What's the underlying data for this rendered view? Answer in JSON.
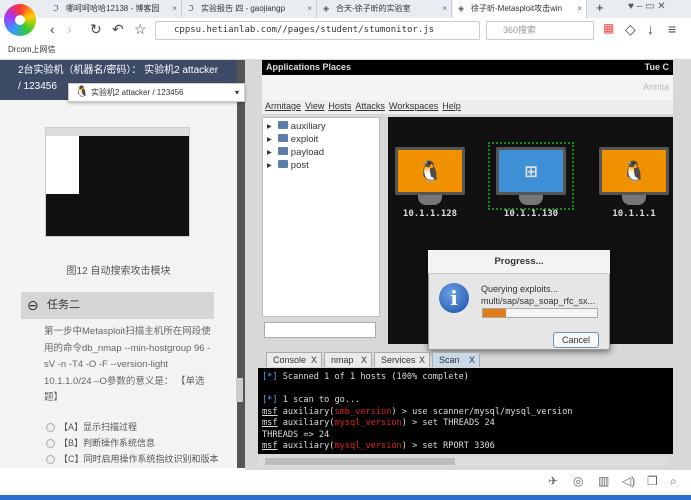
{
  "browser": {
    "tabs": [
      {
        "label": "哪呵呵哈哈12138 - 博客园"
      },
      {
        "label": "实验报告 四 - gaojiangp"
      },
      {
        "label": "合天-徐子昕的实验室"
      },
      {
        "label": "徐子昕-Metasploit攻击win"
      }
    ],
    "url": "cppsu.hetianlab.com//pages/student/stumonitor.js",
    "search_placeholder": "360搜索",
    "bookmark": "Drcom上网信"
  },
  "left": {
    "header": "2台实验机（机器名/密码）： 实验机2 attacker / 123456",
    "dropdown": "实验机2    attacker / 123456",
    "caption": "图12 自动搜索攻击模块",
    "task_title": "任务二",
    "question": "第一步中Metasploit扫描主机所在网段使用的命令db_nmap --min-hostgroup 96 -sV -n -T4 -O -F --version-light 10.1.1.0/24 –O参数的意义是：  【单选题】",
    "options": [
      "【A】显示扫描过程",
      "【B】判断操作系统信息",
      "【C】同时启用操作系统指纹识别和版本检测"
    ]
  },
  "remote": {
    "gnome_bar": "Applications   Places",
    "clock": "Tue C",
    "window_title": "Armita",
    "menu": [
      "Armitage",
      "View",
      "Hosts",
      "Attacks",
      "Workspaces",
      "Help"
    ],
    "modules": [
      "auxiliary",
      "exploit",
      "payload",
      "post"
    ],
    "hosts": [
      {
        "ip": "10.1.1.128",
        "os": "linux"
      },
      {
        "ip": "10.1.1.130",
        "os": "windows"
      },
      {
        "ip": "10.1.1.1",
        "os": "linux"
      }
    ],
    "dialog": {
      "title": "Progress...",
      "line1": "Querying exploits...",
      "line2": "multi/sap/sap_soap_rfc_sx...",
      "progress": 0.2,
      "cancel": "Cancel"
    },
    "console_tabs": [
      "Console",
      "nmap",
      "Services",
      "Scan"
    ],
    "console": {
      "l1": "Scanned 1 of 1 hosts (100% complete)",
      "l2": "1 scan to go...",
      "msf": "msf",
      "aux": " auxiliary(",
      "m1": "smb_version",
      "c1": ") > use scanner/mysql/mysql_version",
      "m2": "mysql_version",
      "c2": ") > set THREADS 24",
      "l3": "THREADS => 24",
      "c3": ") > set RPORT 3306",
      "star": "[*]"
    }
  }
}
